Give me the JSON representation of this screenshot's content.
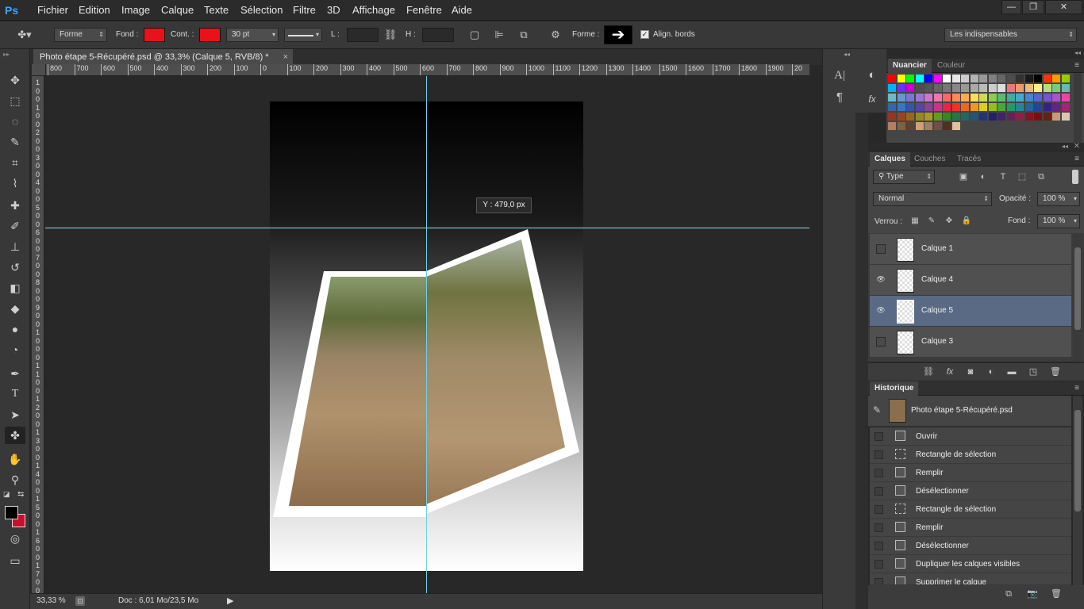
{
  "app": {
    "logo": "Ps"
  },
  "menu": [
    "Fichier",
    "Edition",
    "Image",
    "Calque",
    "Texte",
    "Sélection",
    "Filtre",
    "3D",
    "Affichage",
    "Fenêtre",
    "Aide"
  ],
  "window_buttons": [
    "—",
    "❐",
    "✕"
  ],
  "options": {
    "mode": "Forme",
    "fill_label": "Fond :",
    "stroke_label": "Cont. :",
    "stroke_width": "30 pt",
    "w_label": "L :",
    "h_label": "H :",
    "shape_label": "Forme :",
    "align_label": "Align. bords",
    "align_checked": true,
    "workspace": "Les indispensables",
    "fill_color": "#e8121a",
    "stroke_color": "#e8121a"
  },
  "document": {
    "tab_title": "Photo étape 5-Récupéré.psd @ 33,3% (Calque 5, RVB/8) *",
    "tab_close": "×",
    "zoom": "33,33 %",
    "doc_info": "Doc : 6,01 Mo/23,5 Mo",
    "tooltip": "Y :  479,0 px"
  },
  "rulers": {
    "h": [
      "800",
      "700",
      "600",
      "500",
      "400",
      "300",
      "200",
      "100",
      "0",
      "100",
      "200",
      "300",
      "400",
      "500",
      "600",
      "700",
      "800",
      "900",
      "1000",
      "1100",
      "1200",
      "1300",
      "1400",
      "1500",
      "1600",
      "1700",
      "1800",
      "1900",
      "20"
    ],
    "v": [
      "1",
      "0",
      "0",
      "1",
      "0",
      "0",
      "2",
      "0",
      "0",
      "3",
      "0",
      "0",
      "4",
      "0",
      "0",
      "5",
      "0",
      "0",
      "6",
      "0",
      "0",
      "7",
      "0",
      "0",
      "8",
      "0",
      "0",
      "9",
      "0",
      "0",
      "1",
      "0",
      "0",
      "0",
      "1",
      "1",
      "0",
      "0",
      "1",
      "2",
      "0",
      "0",
      "1",
      "3",
      "0",
      "0",
      "1",
      "4",
      "0",
      "0",
      "1",
      "5",
      "0",
      "0",
      "1",
      "6",
      "0",
      "0",
      "1",
      "7",
      "0",
      "0"
    ]
  },
  "swatches_panel": {
    "tabs": [
      "Nuancier",
      "Couleur"
    ]
  },
  "layers_panel": {
    "tabs": [
      "Calques",
      "Couches",
      "Tracés"
    ],
    "filter": "Type",
    "blend_mode": "Normal",
    "opacity_label": "Opacité :",
    "opacity": "100 %",
    "lock_label": "Verrou :",
    "fill_label": "Fond :",
    "fill": "100 %",
    "layers": [
      {
        "name": "Calque 1",
        "visible": false,
        "selected": false
      },
      {
        "name": "Calque 4",
        "visible": true,
        "selected": false
      },
      {
        "name": "Calque 5",
        "visible": true,
        "selected": true
      },
      {
        "name": "Calque 3",
        "visible": false,
        "selected": false
      }
    ]
  },
  "history_panel": {
    "tab": "Historique",
    "snapshot": "Photo étape 5-Récupéré.psd",
    "items": [
      "Ouvrir",
      "Rectangle de sélection",
      "Remplir",
      "Désélectionner",
      "Rectangle de sélection",
      "Remplir",
      "Désélectionner",
      "Dupliquer les calques visibles",
      "Supprimer le calque"
    ]
  },
  "colors": {
    "foreground": "#000000",
    "background": "#c8102e",
    "guide": "#6fd0e6",
    "accent": "#3fa4ff"
  }
}
